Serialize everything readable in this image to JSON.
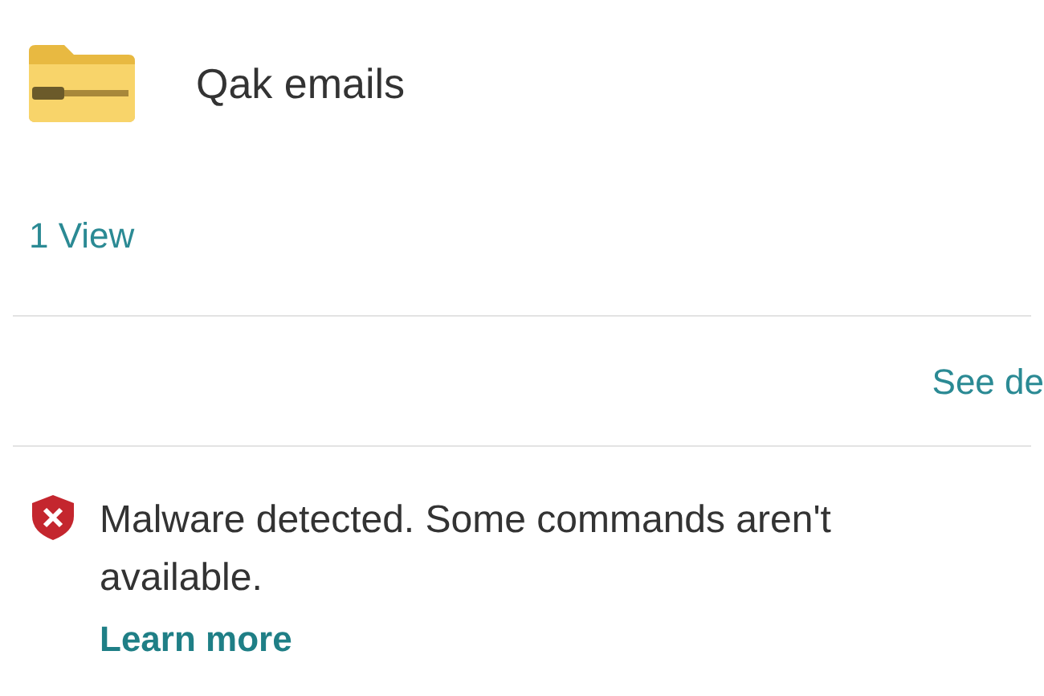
{
  "file": {
    "name": "Qak emails"
  },
  "views_link": "1 View",
  "details_link": "See de",
  "alert": {
    "message": "Malware detected. Some commands aren't available.",
    "link": "Learn more"
  }
}
